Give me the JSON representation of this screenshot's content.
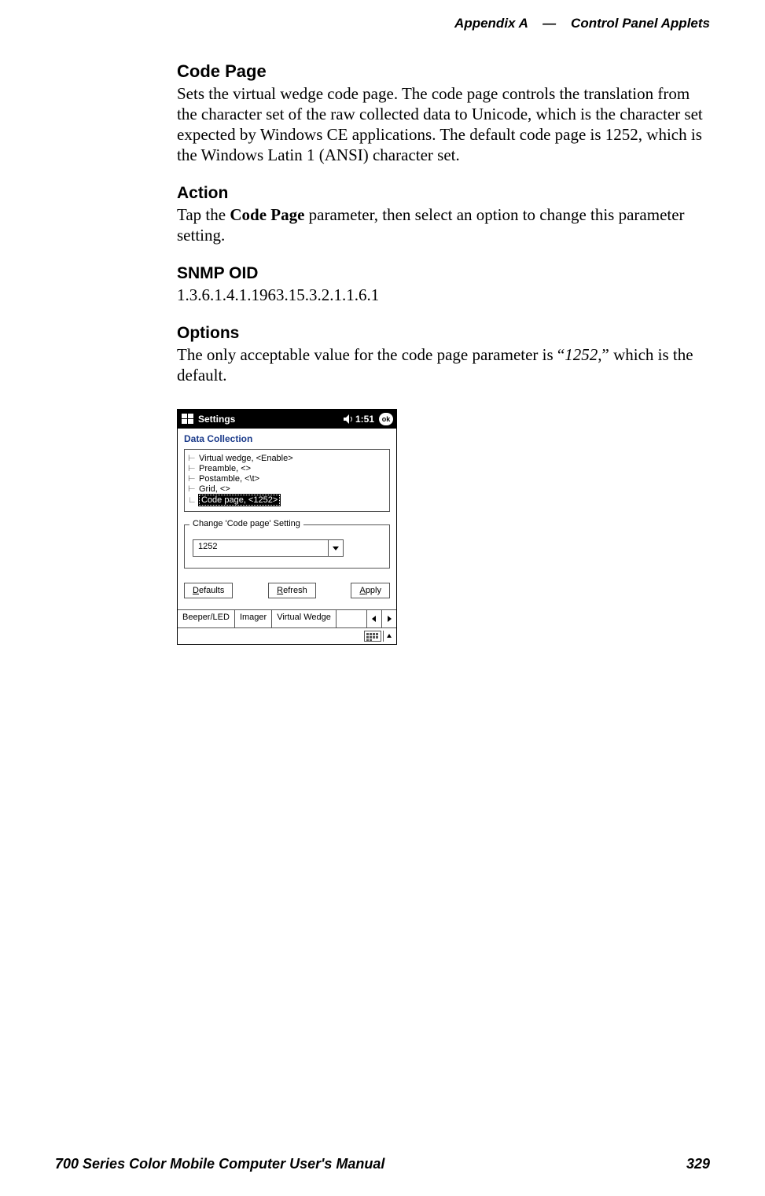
{
  "header": {
    "appendix": "Appendix A",
    "dash": "—",
    "title": "Control Panel Applets"
  },
  "sections": {
    "codepage": {
      "heading": "Code Page",
      "body": "Sets the virtual wedge code page. The code page controls the translation from the character set of the raw collected data to Unicode, which is the character set expected by Windows CE applications. The default code page is 1252, which is the Windows Latin 1 (ANSI) character set."
    },
    "action": {
      "heading": "Action",
      "body_pre": "Tap the ",
      "body_bold": "Code Page",
      "body_post": " parameter, then select an option to change this parameter setting."
    },
    "snmp": {
      "heading": "SNMP OID",
      "value": "1.3.6.1.4.1.1963.15.3.2.1.1.6.1"
    },
    "options": {
      "heading": "Options",
      "body_pre": "The only acceptable value for the code page parameter is “",
      "body_ital": "1252",
      "body_post": ",” which is the default."
    }
  },
  "screenshot": {
    "title": "Settings",
    "time": "1:51",
    "ok": "ok",
    "applet_title": "Data Collection",
    "tree": [
      "Virtual wedge, <Enable>",
      "Preamble, <>",
      "Postamble, <\\t>",
      "Grid, <>",
      "Code page, <1252>"
    ],
    "tree_selected_index": 4,
    "groupbox_legend": "Change 'Code page' Setting",
    "combo_value": "1252",
    "buttons": {
      "defaults": "Defaults",
      "refresh": "Refresh",
      "apply": "Apply"
    },
    "tabs": [
      "Beeper/LED",
      "Imager",
      "Virtual Wedge"
    ]
  },
  "footer": {
    "manual": "700 Series Color Mobile Computer User's Manual",
    "page": "329"
  }
}
